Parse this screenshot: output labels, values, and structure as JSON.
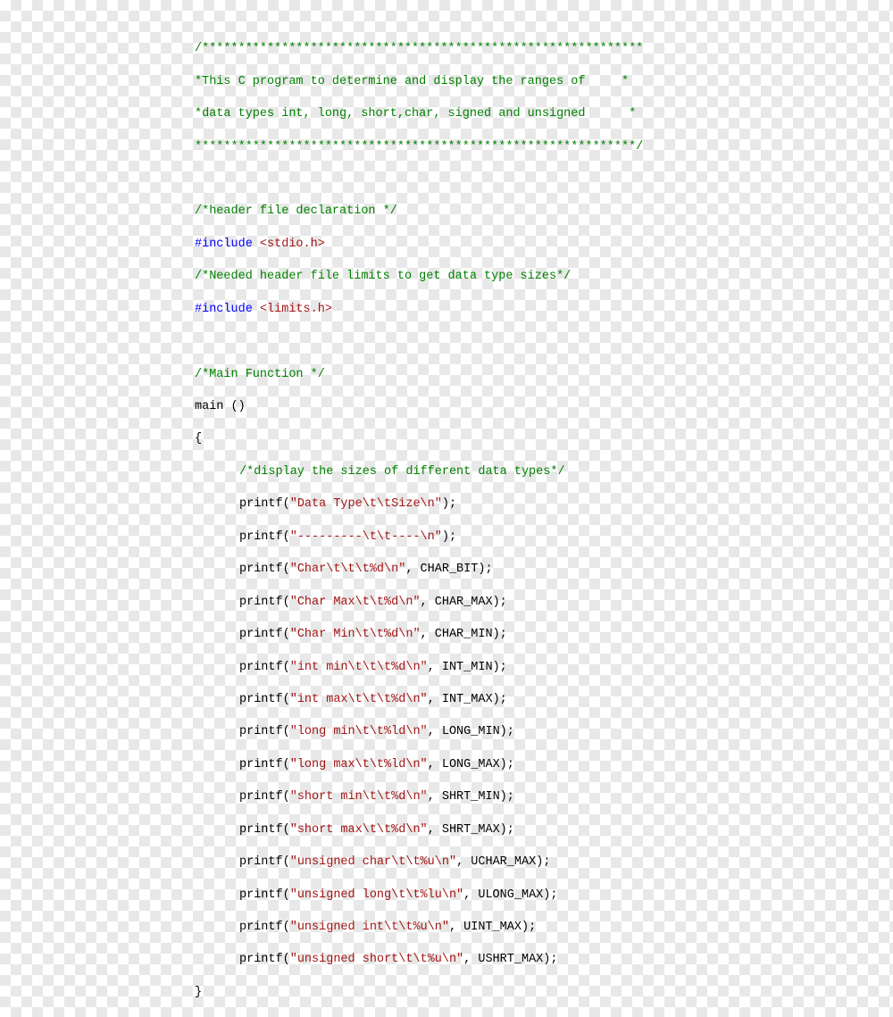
{
  "header_comment": {
    "l1": "/*************************************************************",
    "l2": "*This C program to determine and display the ranges of     *",
    "l3": "*data types int, long, short,char, signed and unsigned      *",
    "l4": "*************************************************************/"
  },
  "comments": {
    "header_decl": "/*header file declaration */",
    "needed": "/*Needed header file limits to get data type sizes*/",
    "main_fn": "/*Main Function */",
    "display": "/*display the sizes of different data types*/"
  },
  "includes": {
    "kw": "#include",
    "h1": "<stdio.h>",
    "h2": "<limits.h>"
  },
  "mainfn": {
    "sig": "main ()",
    "open": "{",
    "close": "}"
  },
  "printf": {
    "fn": "printf(",
    "close": ");",
    "sep": ", "
  },
  "lines": {
    "s0": "\"Data Type\\t\\tSize\\n\"",
    "s1": "\"---------\\t\\t----\\n\"",
    "s2": "\"Char\\t\\t\\t%d\\n\"",
    "a2": "CHAR_BIT",
    "s3": "\"Char Max\\t\\t%d\\n\"",
    "a3": "CHAR_MAX",
    "s4": "\"Char Min\\t\\t%d\\n\"",
    "a4": "CHAR_MIN",
    "s5": "\"int min\\t\\t\\t%d\\n\"",
    "a5": "INT_MIN",
    "s6": "\"int max\\t\\t\\t%d\\n\"",
    "a6": "INT_MAX",
    "s7": "\"long min\\t\\t%ld\\n\"",
    "a7": "LONG_MIN",
    "s8": "\"long max\\t\\t%ld\\n\"",
    "a8": "LONG_MAX",
    "s9": "\"short min\\t\\t%d\\n\"",
    "a9": "SHRT_MIN",
    "s10": "\"short max\\t\\t%d\\n\"",
    "a10": "SHRT_MAX",
    "s11": "\"unsigned char\\t\\t%u\\n\"",
    "a11": "UCHAR_MAX",
    "s12": "\"unsigned long\\t\\t%lu\\n\"",
    "a12": "ULONG_MAX",
    "s13": "\"unsigned int\\t\\t%u\\n\"",
    "a13": "UINT_MAX",
    "s14": "\"unsigned short\\t\\t%u\\n\"",
    "a14": "USHRT_MAX"
  }
}
